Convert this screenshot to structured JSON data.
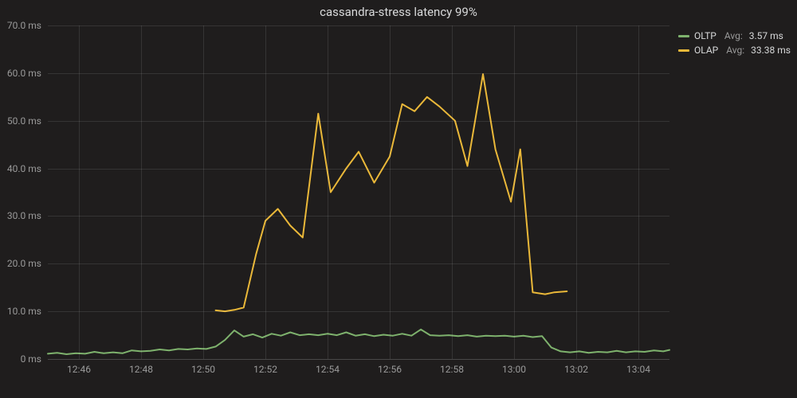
{
  "chart_data": {
    "type": "line",
    "title": "cassandra-stress latency 99%",
    "xlabel": "",
    "ylabel": "",
    "ylim": [
      0,
      70
    ],
    "y_unit": "ms",
    "y_ticks": [
      0,
      10,
      20,
      30,
      40,
      50,
      60,
      70
    ],
    "y_tick_labels": [
      "0 ms",
      "10.0 ms",
      "20.0 ms",
      "30.0 ms",
      "40.0 ms",
      "50.0 ms",
      "60.0 ms",
      "70.0 ms"
    ],
    "x_minutes_range": [
      765,
      785
    ],
    "x_ticks_minutes": [
      766,
      768,
      770,
      772,
      774,
      776,
      778,
      780,
      782,
      784
    ],
    "x_tick_labels": [
      "12:46",
      "12:48",
      "12:50",
      "12:52",
      "12:54",
      "12:56",
      "12:58",
      "13:00",
      "13:02",
      "13:04"
    ],
    "legend": {
      "stat_label": "Avg:",
      "items": [
        {
          "name": "OLTP",
          "color": "#7eb26d",
          "stat_value": "3.57 ms"
        },
        {
          "name": "OLAP",
          "color": "#eab839",
          "stat_value": "33.38 ms"
        }
      ]
    },
    "series": [
      {
        "name": "OLTP",
        "color": "#7eb26d",
        "points": [
          {
            "x": 765.0,
            "y": 1.1
          },
          {
            "x": 765.3,
            "y": 1.3
          },
          {
            "x": 765.6,
            "y": 1.0
          },
          {
            "x": 765.9,
            "y": 1.2
          },
          {
            "x": 766.2,
            "y": 1.1
          },
          {
            "x": 766.5,
            "y": 1.5
          },
          {
            "x": 766.8,
            "y": 1.2
          },
          {
            "x": 767.1,
            "y": 1.4
          },
          {
            "x": 767.4,
            "y": 1.2
          },
          {
            "x": 767.7,
            "y": 1.8
          },
          {
            "x": 768.0,
            "y": 1.6
          },
          {
            "x": 768.3,
            "y": 1.7
          },
          {
            "x": 768.6,
            "y": 2.0
          },
          {
            "x": 768.9,
            "y": 1.8
          },
          {
            "x": 769.2,
            "y": 2.1
          },
          {
            "x": 769.5,
            "y": 2.0
          },
          {
            "x": 769.8,
            "y": 2.2
          },
          {
            "x": 770.1,
            "y": 2.1
          },
          {
            "x": 770.4,
            "y": 2.6
          },
          {
            "x": 770.7,
            "y": 4.0
          },
          {
            "x": 771.0,
            "y": 6.0
          },
          {
            "x": 771.3,
            "y": 4.7
          },
          {
            "x": 771.6,
            "y": 5.2
          },
          {
            "x": 771.9,
            "y": 4.5
          },
          {
            "x": 772.2,
            "y": 5.3
          },
          {
            "x": 772.5,
            "y": 4.9
          },
          {
            "x": 772.8,
            "y": 5.6
          },
          {
            "x": 773.1,
            "y": 5.0
          },
          {
            "x": 773.4,
            "y": 5.2
          },
          {
            "x": 773.7,
            "y": 5.0
          },
          {
            "x": 774.0,
            "y": 5.3
          },
          {
            "x": 774.3,
            "y": 5.0
          },
          {
            "x": 774.6,
            "y": 5.6
          },
          {
            "x": 774.9,
            "y": 4.9
          },
          {
            "x": 775.2,
            "y": 5.2
          },
          {
            "x": 775.5,
            "y": 4.8
          },
          {
            "x": 775.8,
            "y": 5.1
          },
          {
            "x": 776.1,
            "y": 4.9
          },
          {
            "x": 776.4,
            "y": 5.3
          },
          {
            "x": 776.7,
            "y": 4.9
          },
          {
            "x": 777.0,
            "y": 6.2
          },
          {
            "x": 777.3,
            "y": 5.0
          },
          {
            "x": 777.6,
            "y": 4.9
          },
          {
            "x": 777.9,
            "y": 5.0
          },
          {
            "x": 778.2,
            "y": 4.8
          },
          {
            "x": 778.5,
            "y": 5.0
          },
          {
            "x": 778.8,
            "y": 4.7
          },
          {
            "x": 779.1,
            "y": 4.9
          },
          {
            "x": 779.4,
            "y": 4.8
          },
          {
            "x": 779.7,
            "y": 4.9
          },
          {
            "x": 780.0,
            "y": 4.7
          },
          {
            "x": 780.3,
            "y": 4.9
          },
          {
            "x": 780.6,
            "y": 4.6
          },
          {
            "x": 780.9,
            "y": 4.8
          },
          {
            "x": 781.2,
            "y": 2.4
          },
          {
            "x": 781.5,
            "y": 1.6
          },
          {
            "x": 781.8,
            "y": 1.4
          },
          {
            "x": 782.1,
            "y": 1.6
          },
          {
            "x": 782.4,
            "y": 1.3
          },
          {
            "x": 782.7,
            "y": 1.5
          },
          {
            "x": 783.0,
            "y": 1.4
          },
          {
            "x": 783.3,
            "y": 1.7
          },
          {
            "x": 783.6,
            "y": 1.4
          },
          {
            "x": 783.9,
            "y": 1.6
          },
          {
            "x": 784.2,
            "y": 1.5
          },
          {
            "x": 784.5,
            "y": 1.8
          },
          {
            "x": 784.8,
            "y": 1.6
          },
          {
            "x": 785.0,
            "y": 1.9
          }
        ]
      },
      {
        "name": "OLAP",
        "color": "#eab839",
        "points": [
          {
            "x": 770.4,
            "y": 10.2
          },
          {
            "x": 770.7,
            "y": 10.0
          },
          {
            "x": 771.0,
            "y": 10.3
          },
          {
            "x": 771.3,
            "y": 10.8
          },
          {
            "x": 771.7,
            "y": 22.0
          },
          {
            "x": 772.0,
            "y": 29.0
          },
          {
            "x": 772.4,
            "y": 31.5
          },
          {
            "x": 772.8,
            "y": 28.0
          },
          {
            "x": 773.2,
            "y": 25.5
          },
          {
            "x": 773.7,
            "y": 51.5
          },
          {
            "x": 774.1,
            "y": 35.0
          },
          {
            "x": 774.6,
            "y": 40.0
          },
          {
            "x": 775.0,
            "y": 43.5
          },
          {
            "x": 775.5,
            "y": 37.0
          },
          {
            "x": 776.0,
            "y": 42.5
          },
          {
            "x": 776.4,
            "y": 53.5
          },
          {
            "x": 776.8,
            "y": 52.0
          },
          {
            "x": 777.2,
            "y": 55.0
          },
          {
            "x": 777.6,
            "y": 53.0
          },
          {
            "x": 778.1,
            "y": 50.0
          },
          {
            "x": 778.5,
            "y": 40.5
          },
          {
            "x": 779.0,
            "y": 59.8
          },
          {
            "x": 779.4,
            "y": 44.0
          },
          {
            "x": 779.9,
            "y": 33.0
          },
          {
            "x": 780.2,
            "y": 44.0
          },
          {
            "x": 780.6,
            "y": 14.0
          },
          {
            "x": 781.0,
            "y": 13.6
          },
          {
            "x": 781.3,
            "y": 14.0
          },
          {
            "x": 781.7,
            "y": 14.2
          }
        ]
      }
    ]
  }
}
